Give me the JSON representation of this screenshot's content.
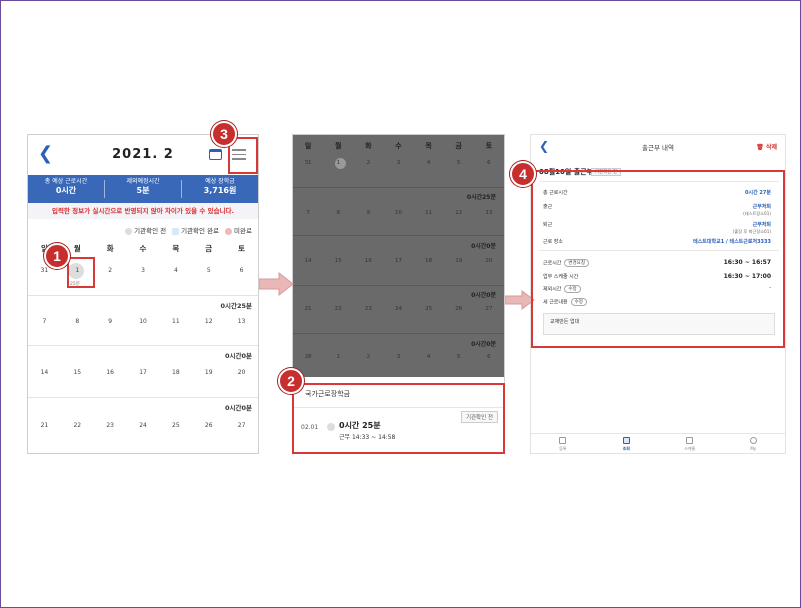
{
  "screen1": {
    "month": "2021. 2",
    "summary": [
      {
        "label": "총 예상 근로시간",
        "value": "0시간"
      },
      {
        "label": "제외예정시간",
        "value": "5분"
      },
      {
        "label": "예상 장학금",
        "value": "3,716원"
      }
    ],
    "warning": "입력한 정보가 실시간으로 반영되지 않아 차이가 있을 수 있습니다.",
    "legend": [
      "기관확인 전",
      "기관확인 완료",
      "미완료"
    ],
    "weekdays": [
      "일",
      "월",
      "화",
      "수",
      "목",
      "금",
      "토"
    ],
    "weeks": [
      {
        "days": [
          "31",
          "1",
          "2",
          "3",
          "4",
          "5",
          "6"
        ],
        "total": "0시간25분"
      },
      {
        "days": [
          "7",
          "8",
          "9",
          "10",
          "11",
          "12",
          "13"
        ],
        "total": "0시간0분"
      },
      {
        "days": [
          "14",
          "15",
          "16",
          "17",
          "18",
          "19",
          "20"
        ],
        "total": "0시간0분"
      },
      {
        "days": [
          "21",
          "22",
          "23",
          "24",
          "25",
          "26",
          "27"
        ],
        "total": ""
      }
    ],
    "day1_sub": "25분"
  },
  "screen2": {
    "weekdays": [
      "일",
      "월",
      "화",
      "수",
      "목",
      "금",
      "토"
    ],
    "weeks": [
      {
        "days": [
          "31",
          "1",
          "2",
          "3",
          "4",
          "5",
          "6"
        ],
        "total": "0시간25분"
      },
      {
        "days": [
          "7",
          "8",
          "9",
          "10",
          "11",
          "12",
          "13"
        ],
        "total": "0시간0분"
      },
      {
        "days": [
          "14",
          "15",
          "16",
          "17",
          "18",
          "19",
          "20"
        ],
        "total": "0시간0분"
      },
      {
        "days": [
          "21",
          "22",
          "23",
          "24",
          "25",
          "26",
          "27"
        ],
        "total": "0시간0분"
      },
      {
        "days": [
          "28",
          "1",
          "2",
          "3",
          "4",
          "5",
          "6"
        ],
        "total": ""
      }
    ],
    "sheet_title": "국가근로장학금",
    "badge": "기관확인 전",
    "entry_date": "02.01",
    "entry_duration": "0시간 25분",
    "entry_work": "근무 14:33 ~ 14:58"
  },
  "screen3": {
    "title": "출근부 내역",
    "delete": "삭제",
    "header": "08월10일 출근부",
    "tag": "기관확인 전",
    "rows": [
      {
        "label": "총 근로시간",
        "value": "0시간 27분",
        "sub": ""
      },
      {
        "label": "출근",
        "value": "근무처퇴",
        "sub": "(테스트장소01)"
      },
      {
        "label": "퇴근",
        "value": "근무처퇴",
        "sub": "(출장 후 퇴근장소01)"
      },
      {
        "label": "근로 장소",
        "value": "테스트대학교1 / 테스트근로처3333",
        "sub": ""
      }
    ],
    "time_rows": [
      {
        "label": "근로시간",
        "btn": "변경요청",
        "value": "16:30 ~ 16:57"
      },
      {
        "label": "업무 스케줄 시간",
        "btn": "",
        "value": "16:30 ~ 17:00"
      },
      {
        "label": "제외시간",
        "btn": "수정",
        "value": "-"
      },
      {
        "label": "세 근로내용",
        "btn": "수정",
        "value": ""
      }
    ],
    "memo": "교재만든 업대",
    "tabs": [
      "등록",
      "조회",
      "스케줄",
      "My"
    ]
  },
  "markers": [
    "1",
    "2",
    "3",
    "4"
  ],
  "colors": {
    "accent": "#3a68b8",
    "highlight": "#d83838",
    "marker": "#c72e2e"
  }
}
